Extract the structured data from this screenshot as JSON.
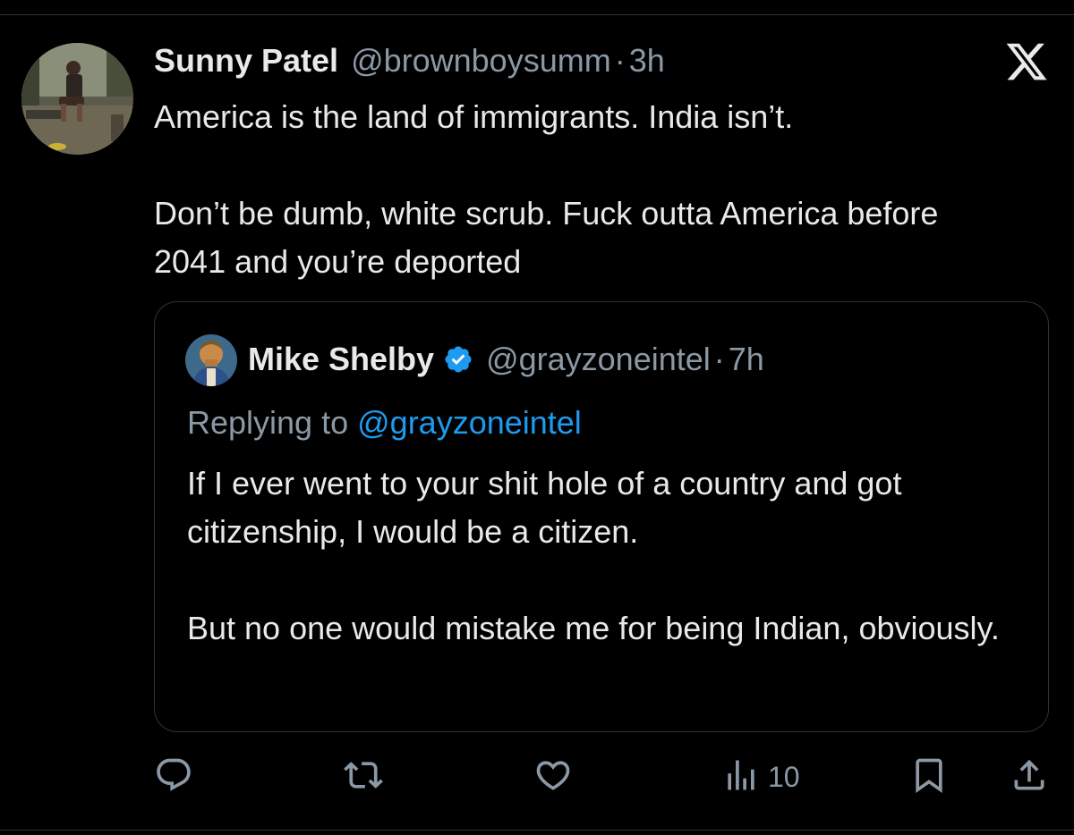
{
  "tweet": {
    "author_name": "Sunny Patel",
    "author_handle": "@brownboysumm",
    "separator": "·",
    "time": "3h",
    "text": "America is the land of immigrants. India isn’t.\n\nDon’t be dumb, white scrub. Fuck outta America before 2041 and you’re deported"
  },
  "quoted_tweet": {
    "author_name": "Mike Shelby",
    "author_handle": "@grayzoneintel",
    "separator": "·",
    "time": "7h",
    "replying_label": "Replying to",
    "replying_to": "@grayzoneintel",
    "text": "If I ever went to your shit hole of a country and got citizenship, I would be a citizen.\n\nBut no one would mistake me for being Indian, obviously."
  },
  "actions": {
    "views_count": "10"
  },
  "icons": {
    "brand": "x-logo-icon",
    "verified": "verified-badge-icon",
    "reply": "reply-icon",
    "retweet": "retweet-icon",
    "like": "heart-icon",
    "views": "views-icon",
    "bookmark": "bookmark-icon",
    "share": "share-icon"
  },
  "colors": {
    "background": "#000000",
    "text": "#e7e9ea",
    "muted": "#8b98a5",
    "accent": "#1d9bf0",
    "border": "#2f3336"
  }
}
